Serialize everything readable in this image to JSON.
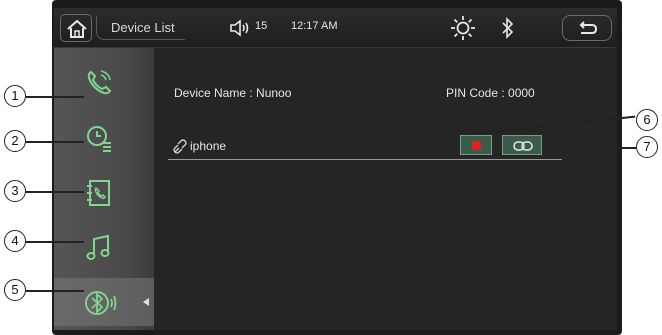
{
  "topbar": {
    "title": "Device List",
    "volume": "15",
    "time": "12:17 AM"
  },
  "sidebar": {
    "items": [
      {
        "icon": "phone-icon"
      },
      {
        "icon": "call-history-icon"
      },
      {
        "icon": "contacts-icon"
      },
      {
        "icon": "music-icon"
      },
      {
        "icon": "bluetooth-settings-icon",
        "active": true
      }
    ]
  },
  "content": {
    "device_name_label": "Device Name : Nunoo",
    "pin_label": "PIN Code : 0000",
    "paired_devices": [
      {
        "name": "iphone"
      }
    ]
  },
  "callouts": {
    "c1": "1",
    "c2": "2",
    "c3": "3",
    "c4": "4",
    "c5": "5",
    "c6": "6",
    "c7": "7"
  },
  "colors": {
    "screen_bg": "#262626",
    "sidebar_bg": "#4a4a4a",
    "icon_green": "#7fd68c",
    "button_bg": "#3a5c4a",
    "delete_red": "#e22222"
  }
}
